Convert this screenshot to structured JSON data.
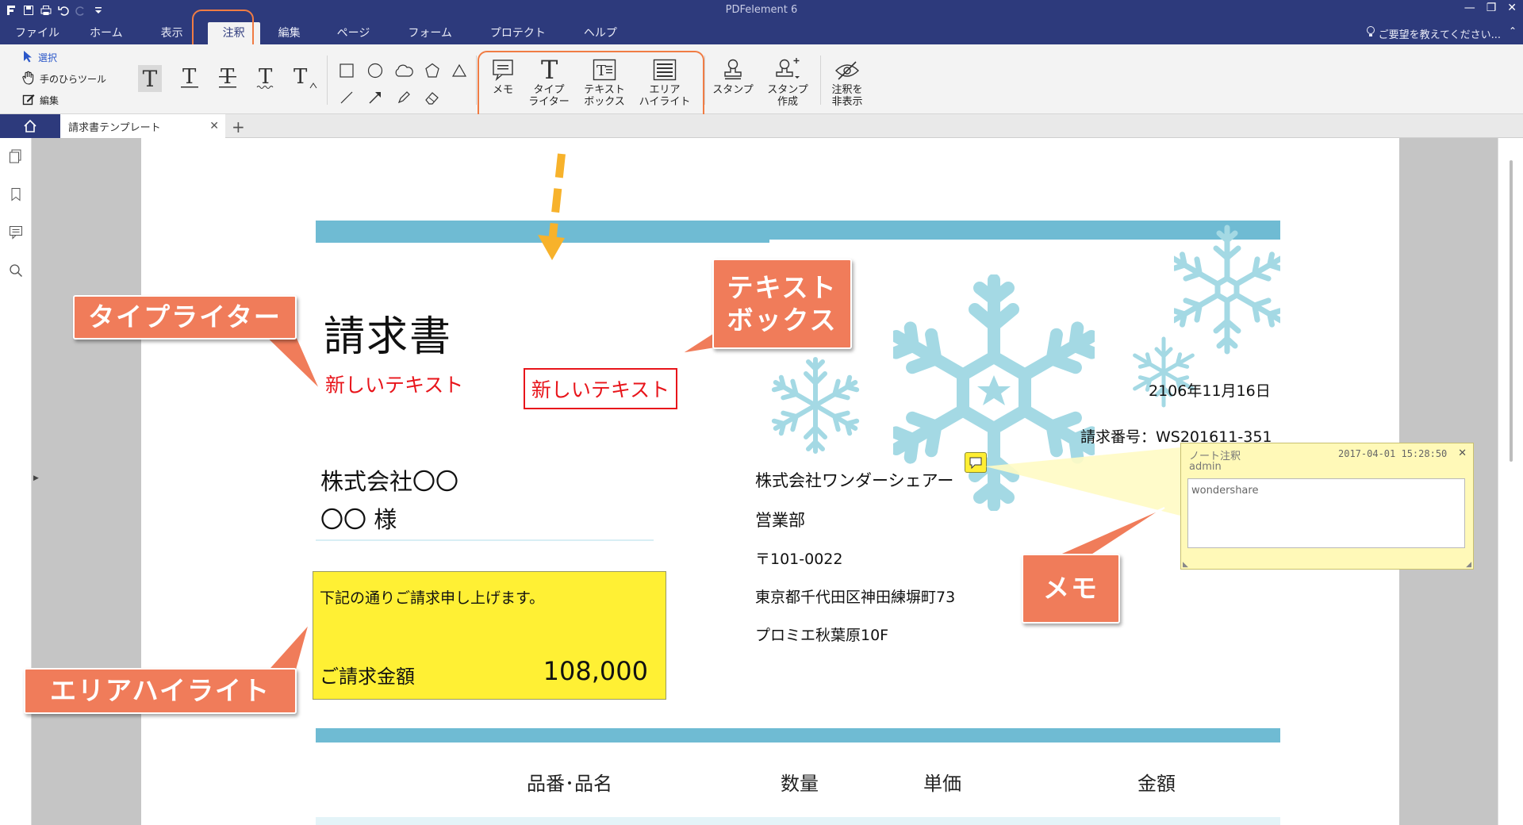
{
  "app": {
    "title": "PDFelement 6",
    "menu": [
      "ファイル",
      "ホーム",
      "表示",
      "注釈",
      "編集",
      "ページ",
      "フォーム",
      "プロテクト",
      "ヘルプ"
    ],
    "active_menu": "注釈",
    "help_text": "ご要望を教えてください...",
    "window_controls": [
      "minimize-icon",
      "restore-icon",
      "close-icon"
    ]
  },
  "ribbon": {
    "select_label": "選択",
    "hand_label": "手のひらツール",
    "edit_label": "編集",
    "memo_label": "メモ",
    "typewriter_label_1": "タイプ",
    "typewriter_label_2": "ライター",
    "textbox_label_1": "テキスト",
    "textbox_label_2": "ボックス",
    "area_label_1": "エリア",
    "area_label_2": "ハイライト",
    "stamp_label": "スタンプ",
    "stamp_create_label_1": "スタンプ",
    "stamp_create_label_2": "作成",
    "hide_label_1": "注釈を",
    "hide_label_2": "非表示"
  },
  "tabs": {
    "doc_tab": "請求書テンプレート",
    "add_label": "+"
  },
  "document": {
    "title": "請求書",
    "typewriter_text": "新しいテキスト",
    "textbox_text": "新しいテキスト",
    "date": "2106年11月16日",
    "invoice_no": "請求番号：WS201611-351",
    "customer_company": "株式会社〇〇",
    "customer_name": "〇〇 様",
    "supplier_company": "株式会社ワンダーシェアー",
    "department": "営業部",
    "postal": "〒101-0022",
    "address": "東京都千代田区神田練塀町73",
    "building": "プロミエ秋葉原10F",
    "highlight_line": "下記の通りご請求申し上げます。",
    "amount_label": "ご請求金額",
    "amount_value": "108,000",
    "table_headers": [
      "品番･品名",
      "数量",
      "単価",
      "金額"
    ]
  },
  "note": {
    "title": "ノート注釈",
    "timestamp": "2017-04-01 15:28:50",
    "author": "admin",
    "content": "wondershare"
  },
  "callouts": {
    "typewriter": "タイプライター",
    "textbox_1": "テキスト",
    "textbox_2": "ボックス",
    "area": "エリアハイライト",
    "memo": "メモ"
  },
  "colors": {
    "titlebar": "#2d3a7c",
    "callout": "#f07c5a",
    "accent_bar": "#6fbbd3",
    "highlight": "#fff034",
    "red_text": "#e8151b",
    "snowflake": "#a4d9e4"
  }
}
